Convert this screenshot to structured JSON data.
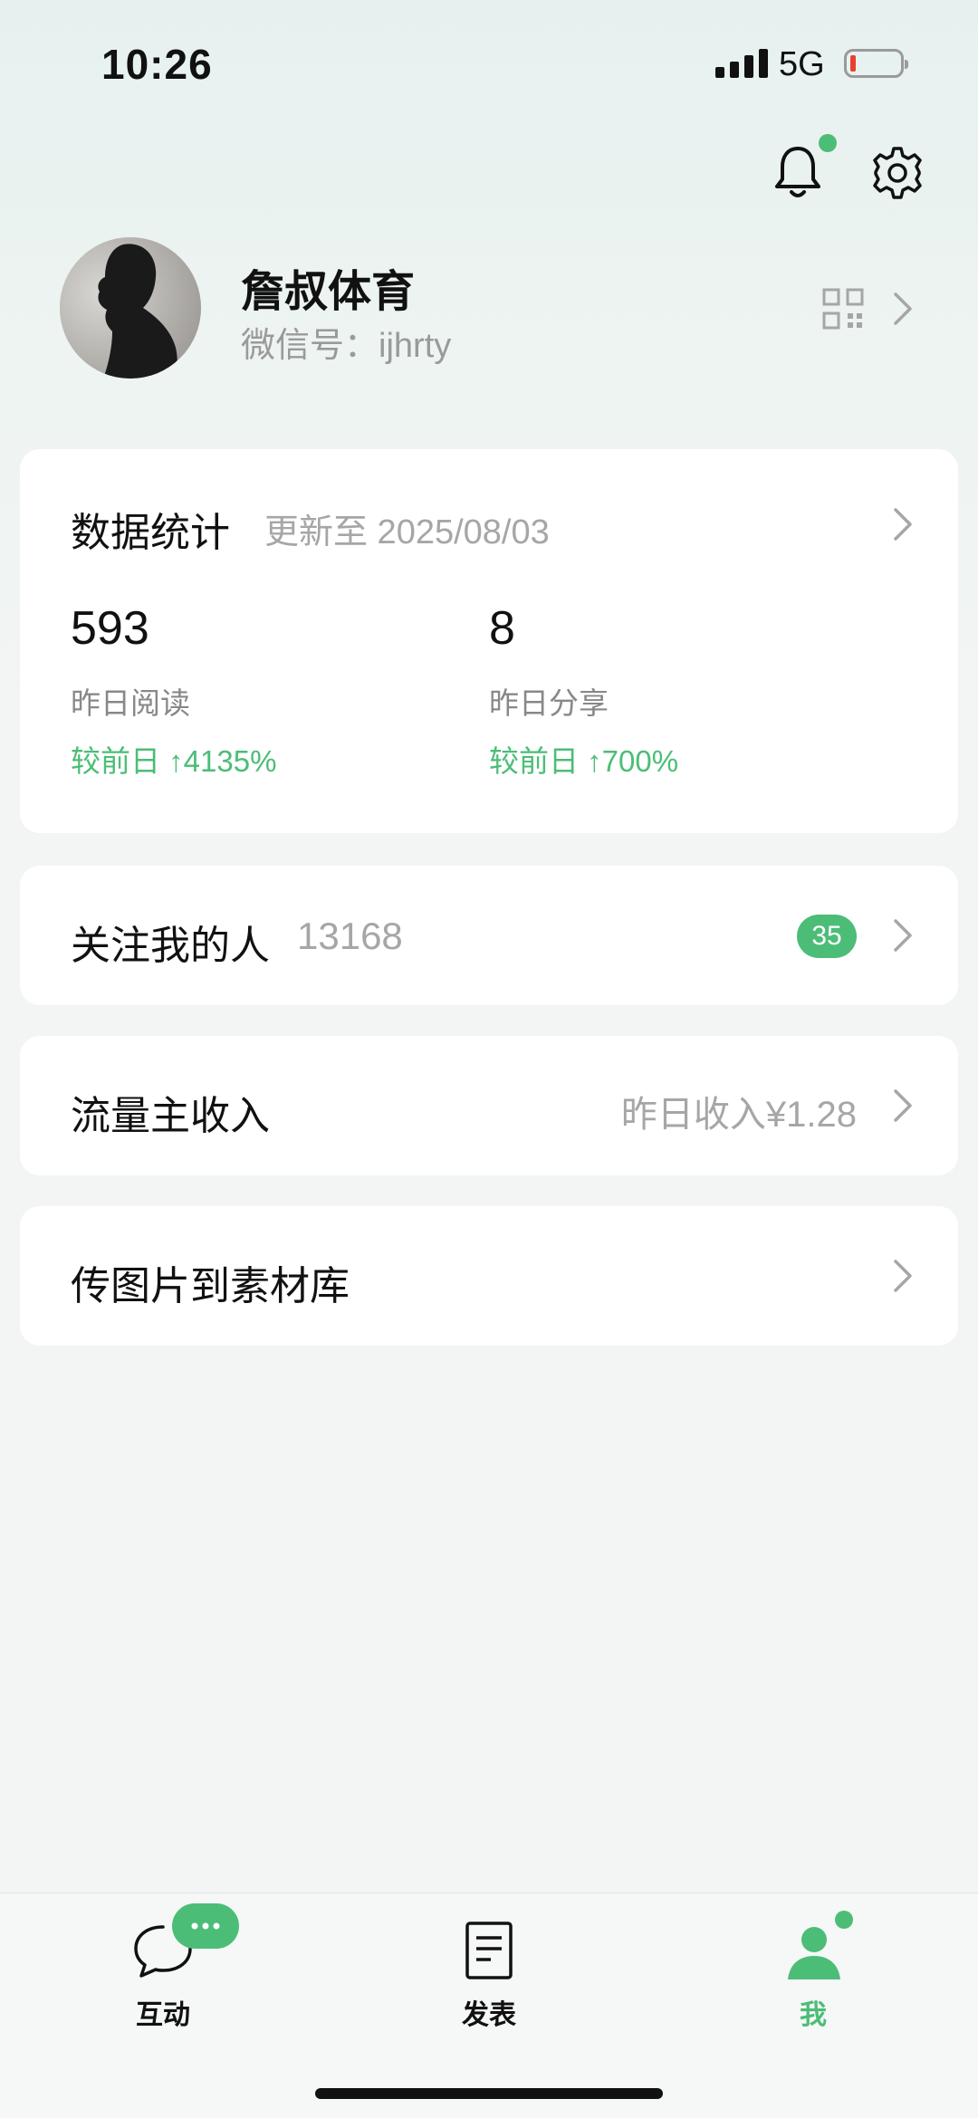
{
  "status_bar": {
    "time": "10:26",
    "network": "5G"
  },
  "profile": {
    "name": "詹叔体育",
    "wechat_id_label": "微信号：",
    "wechat_id": "ijhrty"
  },
  "stats": {
    "title": "数据统计",
    "updated": "更新至 2025/08/03",
    "items": [
      {
        "value": "593",
        "label": "昨日阅读",
        "change": "较前日 ↑4135%"
      },
      {
        "value": "8",
        "label": "昨日分享",
        "change": "较前日 ↑700%"
      }
    ]
  },
  "followers": {
    "label": "关注我的人",
    "count": "13168",
    "badge": "35"
  },
  "income": {
    "label": "流量主收入",
    "detail": "昨日收入¥1.28"
  },
  "upload": {
    "label": "传图片到素材库"
  },
  "tabs": [
    {
      "label": "互动",
      "icon": "chat-icon"
    },
    {
      "label": "发表",
      "icon": "document-icon"
    },
    {
      "label": "我",
      "icon": "person-icon",
      "active": true
    }
  ],
  "colors": {
    "accent": "#4cbd77"
  }
}
